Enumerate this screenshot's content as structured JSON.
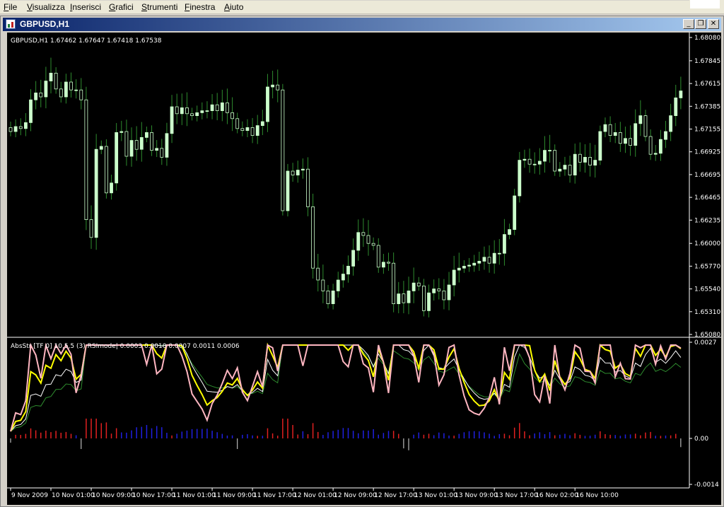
{
  "menu": [
    "File",
    "Visualizza",
    "Inserisci",
    "Grafici",
    "Strumenti",
    "Finestra",
    "Aiuto"
  ],
  "window": {
    "title": "GBPUSD,H1",
    "minimize_glyph": "_",
    "restore_glyph": "❐",
    "close_glyph": "✕"
  },
  "colors": {
    "background": "#000000",
    "candle": "#ccffcc",
    "wick": "#2e8b2e",
    "bid_line": "#c0c0c0",
    "rsi_pink": "#ffb6c1",
    "rsi_yellow": "#ffff00",
    "rsi_white": "#ffffff",
    "rsi_green": "#2e8b2e",
    "hist_red": "#e02020",
    "hist_blue": "#2020e0",
    "hist_white": "#e0e0e0"
  },
  "price_panel": {
    "header": "GBPUSD,H1  1.67462 1.67647 1.67418 1.67538",
    "current_price_label": "1.67538",
    "current_price": 1.67538
  },
  "indicator_panel": {
    "header": "AbsStr [TF 0] 10,5,5 (3) RSImode|  0.0003 0.0010 0.0007 0.0011 0.0006"
  },
  "chart_data": [
    {
      "type": "candlestick",
      "title": "",
      "ylim": [
        1.6508,
        1.6808
      ],
      "y_ticks": [
        "1.68080",
        "1.67845",
        "1.67615",
        "1.67385",
        "1.67155",
        "1.66925",
        "1.66695",
        "1.66465",
        "1.66235",
        "1.66000",
        "1.65770",
        "1.65540",
        "1.65310",
        "1.65080"
      ],
      "x_ticks": [
        "9 Nov 2009",
        "10 Nov 01:00",
        "10 Nov 09:00",
        "10 Nov 17:00",
        "11 Nov 01:00",
        "11 Nov 09:00",
        "11 Nov 17:00",
        "12 Nov 01:00",
        "12 Nov 09:00",
        "12 Nov 17:00",
        "13 Nov 01:00",
        "13 Nov 09:00",
        "13 Nov 17:00",
        "16 Nov 02:00",
        "16 Nov 10:00"
      ],
      "x_anchors": [
        {
          "label": "9 Nov 2009",
          "index": 0
        },
        {
          "label": "10 Nov 01:00",
          "index": 8
        },
        {
          "label": "10 Nov 09:00",
          "index": 16
        },
        {
          "label": "10 Nov 17:00",
          "index": 24
        },
        {
          "label": "11 Nov 01:00",
          "index": 32
        },
        {
          "label": "11 Nov 09:00",
          "index": 40
        },
        {
          "label": "11 Nov 17:00",
          "index": 48
        },
        {
          "label": "12 Nov 01:00",
          "index": 56
        },
        {
          "label": "12 Nov 09:00",
          "index": 64
        },
        {
          "label": "12 Nov 17:00",
          "index": 72
        },
        {
          "label": "13 Nov 01:00",
          "index": 80
        },
        {
          "label": "13 Nov 09:00",
          "index": 88
        },
        {
          "label": "13 Nov 17:00",
          "index": 96
        },
        {
          "label": "16 Nov 02:00",
          "index": 104
        },
        {
          "label": "16 Nov 10:00",
          "index": 112
        }
      ],
      "closes": [
        1.6713,
        1.6718,
        1.6716,
        1.6722,
        1.6745,
        1.6752,
        1.6748,
        1.6764,
        1.6772,
        1.6756,
        1.6748,
        1.6763,
        1.6755,
        1.6755,
        1.6745,
        1.6624,
        1.6606,
        1.6695,
        1.6698,
        1.6651,
        1.6661,
        1.6712,
        1.6713,
        1.6688,
        1.6704,
        1.6695,
        1.6707,
        1.6712,
        1.6694,
        1.6696,
        1.6687,
        1.6711,
        1.6738,
        1.6731,
        1.6737,
        1.6731,
        1.6729,
        1.6732,
        1.6734,
        1.6734,
        1.674,
        1.6734,
        1.6742,
        1.6732,
        1.6726,
        1.6716,
        1.6714,
        1.6717,
        1.6709,
        1.6719,
        1.6723,
        1.6758,
        1.676,
        1.6755,
        1.6633,
        1.6673,
        1.6669,
        1.6674,
        1.6675,
        1.6637,
        1.6575,
        1.6563,
        1.6552,
        1.6539,
        1.6552,
        1.6563,
        1.6569,
        1.6577,
        1.6593,
        1.6611,
        1.6608,
        1.66,
        1.6598,
        1.6576,
        1.6581,
        1.658,
        1.6539,
        1.6549,
        1.654,
        1.6552,
        1.656,
        1.6557,
        1.6532,
        1.655,
        1.6554,
        1.6552,
        1.6543,
        1.6558,
        1.6573,
        1.6575,
        1.6577,
        1.6578,
        1.658,
        1.6582,
        1.6586,
        1.658,
        1.659,
        1.659,
        1.6609,
        1.6614,
        1.6648,
        1.6684,
        1.6685,
        1.668,
        1.668,
        1.6683,
        1.6694,
        1.6694,
        1.6673,
        1.6675,
        1.6679,
        1.6669,
        1.669,
        1.6682,
        1.6687,
        1.6679,
        1.6684,
        1.6713,
        1.672,
        1.6709,
        1.6712,
        1.6701,
        1.6706,
        1.6699,
        1.6721,
        1.6729,
        1.6708,
        1.669,
        1.6691,
        1.6705,
        1.6713,
        1.6729,
        1.6747,
        1.6754
      ]
    },
    {
      "type": "line",
      "title": "",
      "ylim": [
        -0.0014,
        0.0027
      ],
      "y_ticks": [
        "0.0027",
        "0.00",
        "-0.0014"
      ],
      "series": [],
      "histogram": []
    }
  ]
}
